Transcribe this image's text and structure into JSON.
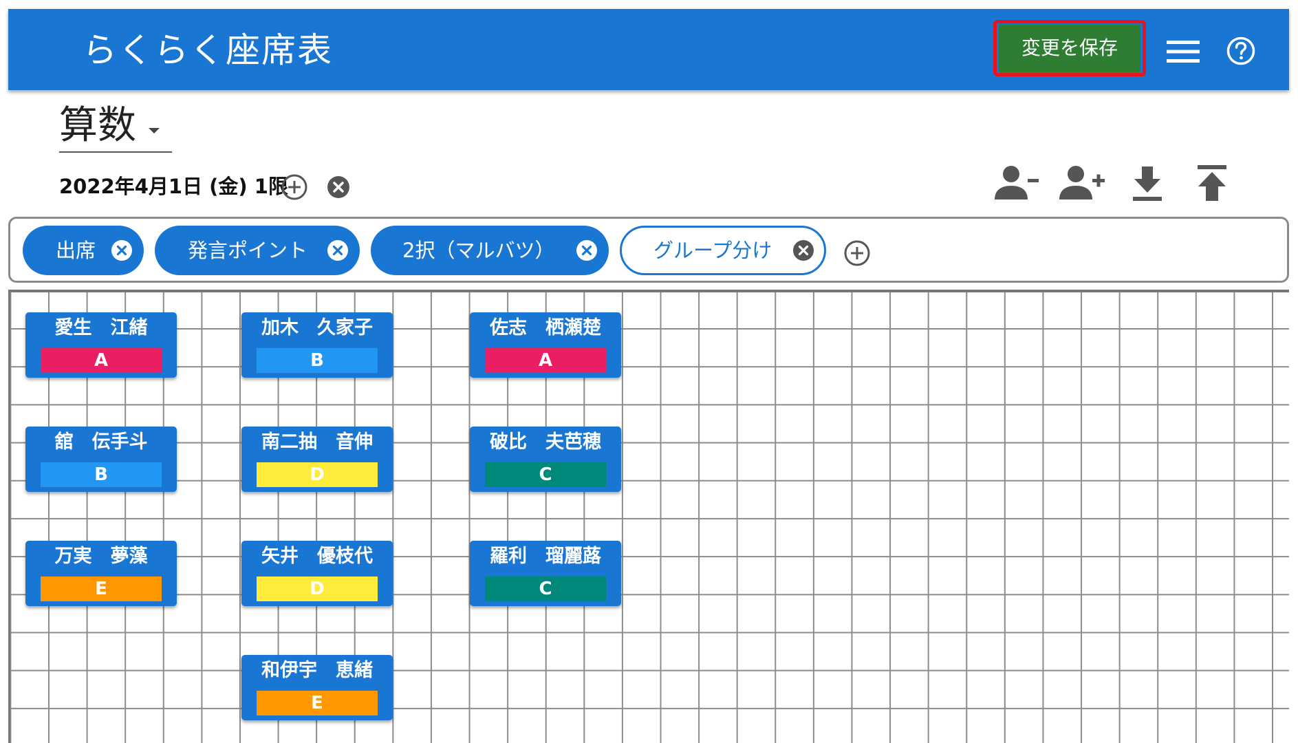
{
  "header": {
    "title": "らくらく座席表",
    "save_label": "変更を保存",
    "menu_icon": "menu-icon",
    "help_icon": "help-icon"
  },
  "subject": {
    "selected": "算数"
  },
  "session": {
    "date_label": "2022年4月1日 (金) 1限"
  },
  "toolbar": {
    "icons": [
      "remove-student-icon",
      "add-student-icon",
      "download-icon",
      "upload-icon"
    ]
  },
  "chips": [
    {
      "label": "出席",
      "selected": true
    },
    {
      "label": "発言ポイント",
      "selected": true
    },
    {
      "label": "2択（マルバツ）",
      "selected": true
    },
    {
      "label": "グループ分け",
      "selected": false
    }
  ],
  "group_colors": {
    "A": "#e91e63",
    "B": "#2196f3",
    "C": "#00897b",
    "D": "#ffeb3b",
    "E": "#ff9800"
  },
  "students": [
    {
      "name": "愛生　江緒",
      "group": "A"
    },
    {
      "name": "舘　伝手斗",
      "group": "B"
    },
    {
      "name": "万実　夢藻",
      "group": "E"
    },
    {
      "name": "加木　久家子",
      "group": "B"
    },
    {
      "name": "南二抽　音伸",
      "group": "D"
    },
    {
      "name": "矢井　優枝代",
      "group": "D"
    },
    {
      "name": "和伊宇　恵緒",
      "group": "E"
    },
    {
      "name": "佐志　栖瀬楚",
      "group": "A"
    },
    {
      "name": "破比　夫芭穂",
      "group": "C"
    },
    {
      "name": "羅利　瑠麗蕗",
      "group": "C"
    }
  ]
}
